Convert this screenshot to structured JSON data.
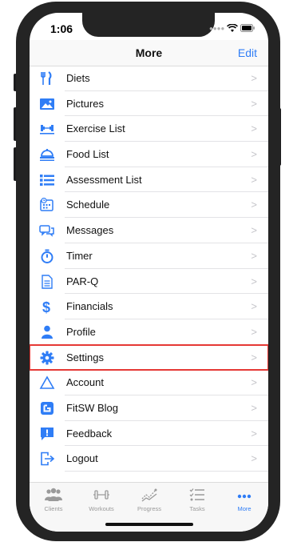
{
  "status": {
    "time": "1:06"
  },
  "nav": {
    "title": "More",
    "edit_label": "Edit"
  },
  "menu": {
    "items": [
      {
        "label": "Diets",
        "icon": "fork-knife-icon"
      },
      {
        "label": "Pictures",
        "icon": "photo-icon"
      },
      {
        "label": "Exercise List",
        "icon": "dumbbell-icon"
      },
      {
        "label": "Food List",
        "icon": "food-tray-icon"
      },
      {
        "label": "Assessment List",
        "icon": "list-icon"
      },
      {
        "label": "Schedule",
        "icon": "calendar-clock-icon"
      },
      {
        "label": "Messages",
        "icon": "chat-bubbles-icon"
      },
      {
        "label": "Timer",
        "icon": "stopwatch-icon"
      },
      {
        "label": "PAR-Q",
        "icon": "document-icon"
      },
      {
        "label": "Financials",
        "icon": "dollar-icon"
      },
      {
        "label": "Profile",
        "icon": "person-icon"
      },
      {
        "label": "Settings",
        "icon": "gear-icon",
        "highlighted": true
      },
      {
        "label": "Account",
        "icon": "triangle-icon"
      },
      {
        "label": "FitSW Blog",
        "icon": "blogger-icon"
      },
      {
        "label": "Feedback",
        "icon": "feedback-icon"
      },
      {
        "label": "Logout",
        "icon": "logout-icon"
      }
    ],
    "chevron": ">"
  },
  "tabbar": {
    "tabs": [
      {
        "label": "Clients",
        "icon": "clients-icon"
      },
      {
        "label": "Workouts",
        "icon": "dumbbell-icon"
      },
      {
        "label": "Progress",
        "icon": "progress-chart-icon"
      },
      {
        "label": "Tasks",
        "icon": "checklist-icon"
      },
      {
        "label": "More",
        "icon": "more-dots-icon",
        "active": true
      }
    ]
  },
  "colors": {
    "accent": "#2f7df6",
    "highlight": "#e53935",
    "inactive": "#9a9a9a"
  }
}
